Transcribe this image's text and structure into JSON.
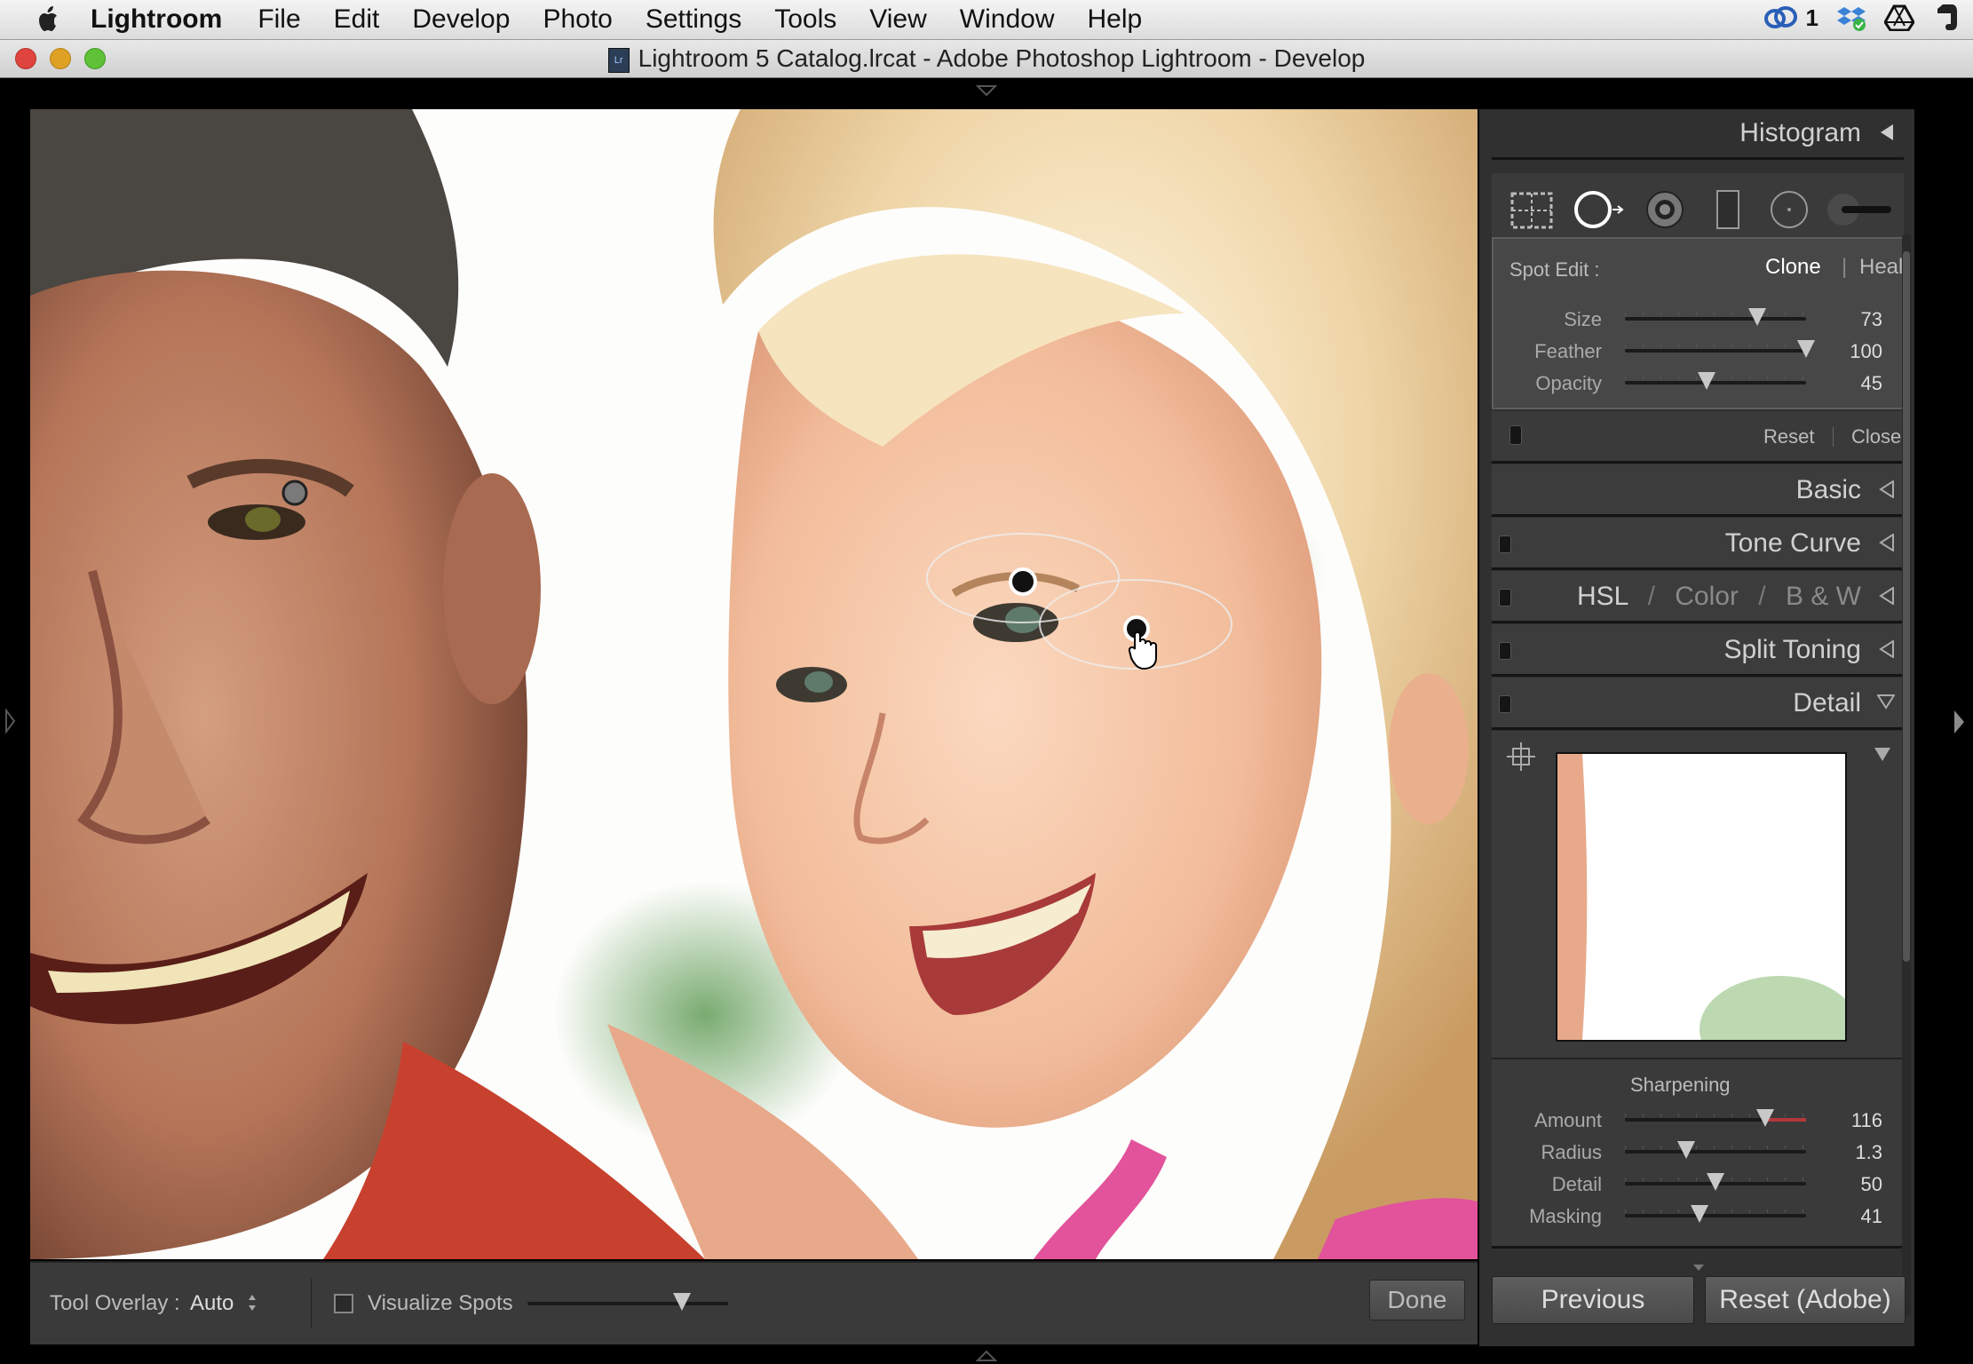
{
  "menubar": {
    "app_name": "Lightroom",
    "items": [
      "File",
      "Edit",
      "Develop",
      "Photo",
      "Settings",
      "Tools",
      "View",
      "Window",
      "Help"
    ],
    "cc_count": "1"
  },
  "window": {
    "title": "Lightroom 5 Catalog.lrcat - Adobe Photoshop Lightroom - Develop"
  },
  "tool_strip": {
    "tools": [
      "crop-overlay-icon",
      "spot-removal-icon",
      "red-eye-icon",
      "graduated-filter-icon",
      "radial-filter-icon",
      "adjustment-brush-icon"
    ],
    "active": "spot-removal-icon"
  },
  "spot_edit": {
    "label": "Spot Edit :",
    "mode_clone": "Clone",
    "separator": "|",
    "mode_heal": "Heal",
    "active_mode": "Clone",
    "sliders": [
      {
        "label": "Size",
        "value": "73",
        "fraction": 0.73
      },
      {
        "label": "Feather",
        "value": "100",
        "fraction": 1.0
      },
      {
        "label": "Opacity",
        "value": "45",
        "fraction": 0.45
      }
    ],
    "reset": "Reset",
    "close": "Close"
  },
  "panels": {
    "histogram": "Histogram",
    "basic": "Basic",
    "tone_curve": "Tone Curve",
    "hsl": "HSL",
    "color": "Color",
    "bw": "B & W",
    "slash": "/",
    "split_toning": "Split Toning",
    "detail": "Detail"
  },
  "detail": {
    "sharpening_title": "Sharpening",
    "sliders": [
      {
        "label": "Amount",
        "value": "116",
        "fraction": 0.775
      },
      {
        "label": "Radius",
        "value": "1.3",
        "fraction": 0.34
      },
      {
        "label": "Detail",
        "value": "50",
        "fraction": 0.5
      },
      {
        "label": "Masking",
        "value": "41",
        "fraction": 0.41
      }
    ]
  },
  "bottom_buttons": {
    "previous": "Previous",
    "reset": "Reset (Adobe)"
  },
  "toolbar": {
    "tool_overlay_label": "Tool Overlay :",
    "tool_overlay_value": "Auto",
    "visualize_spots": "Visualize Spots",
    "visualize_fraction": 0.77,
    "done": "Done"
  },
  "colors": {
    "panel_bg": "#303030",
    "header_bg": "#3c3c3c",
    "amount_red": "#b3383c"
  }
}
